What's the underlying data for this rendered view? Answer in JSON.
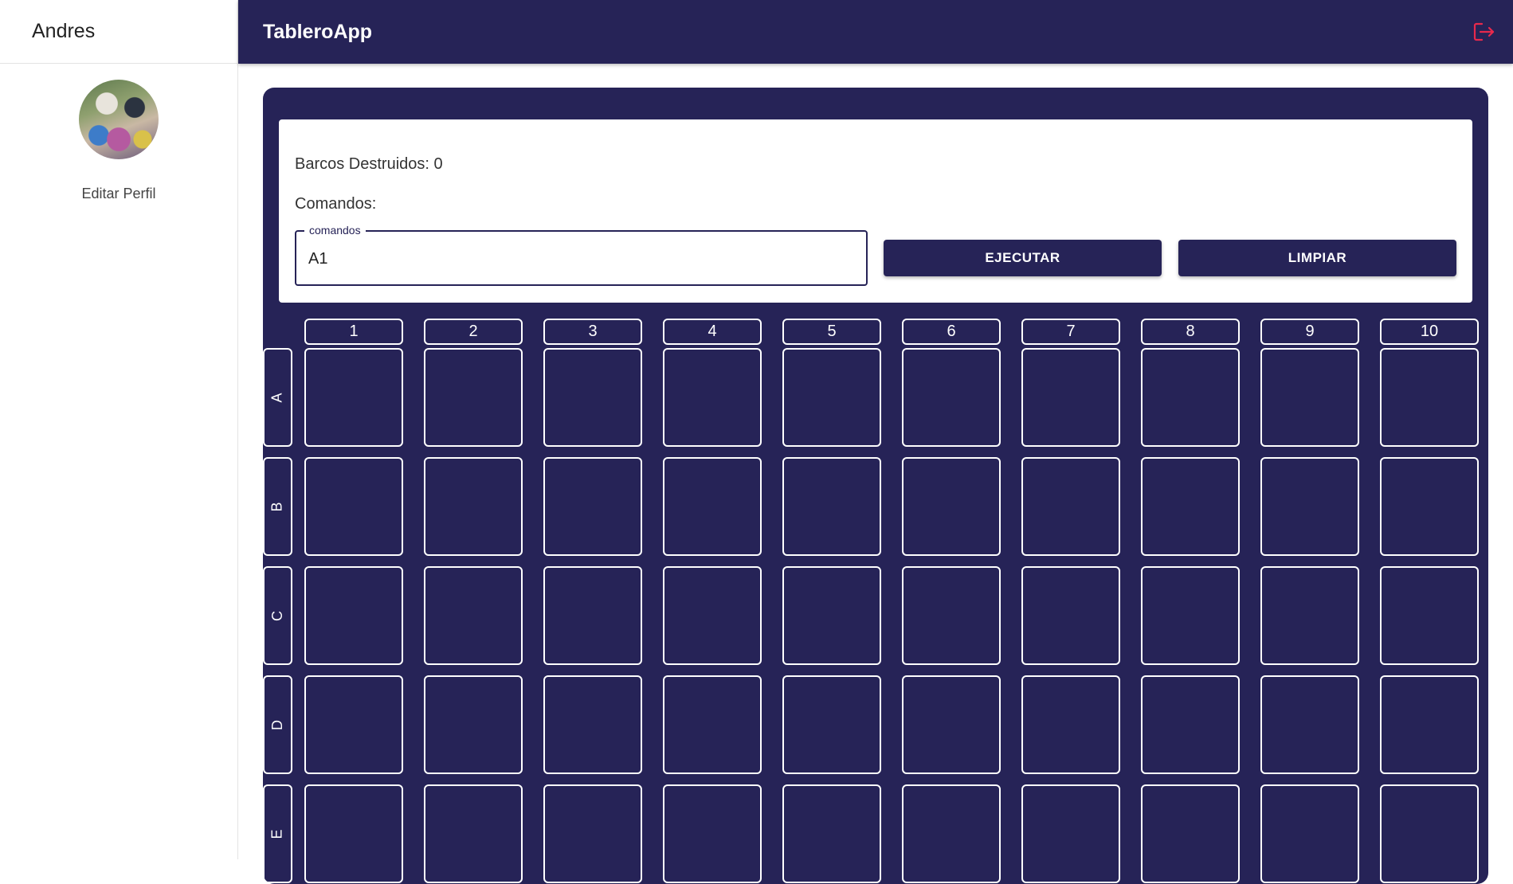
{
  "sidebar": {
    "username": "Andres",
    "edit_profile_label": "Editar Perfil"
  },
  "header": {
    "app_title": "TableroApp",
    "logout_icon": "logout-icon"
  },
  "game": {
    "destroyed_label": "Barcos Destruidos: 0",
    "commands_label": "Comandos:",
    "command_field": {
      "legend": "comandos",
      "value": "A1"
    },
    "execute_label": "EJECUTAR",
    "clear_label": "LIMPIAR",
    "columns": [
      "1",
      "2",
      "3",
      "4",
      "5",
      "6",
      "7",
      "8",
      "9",
      "10"
    ],
    "rows": [
      "A",
      "B",
      "C",
      "D",
      "E"
    ]
  },
  "colors": {
    "primary": "#262357",
    "logout_accent": "#e8294c",
    "cell_border": "#ffffff"
  }
}
